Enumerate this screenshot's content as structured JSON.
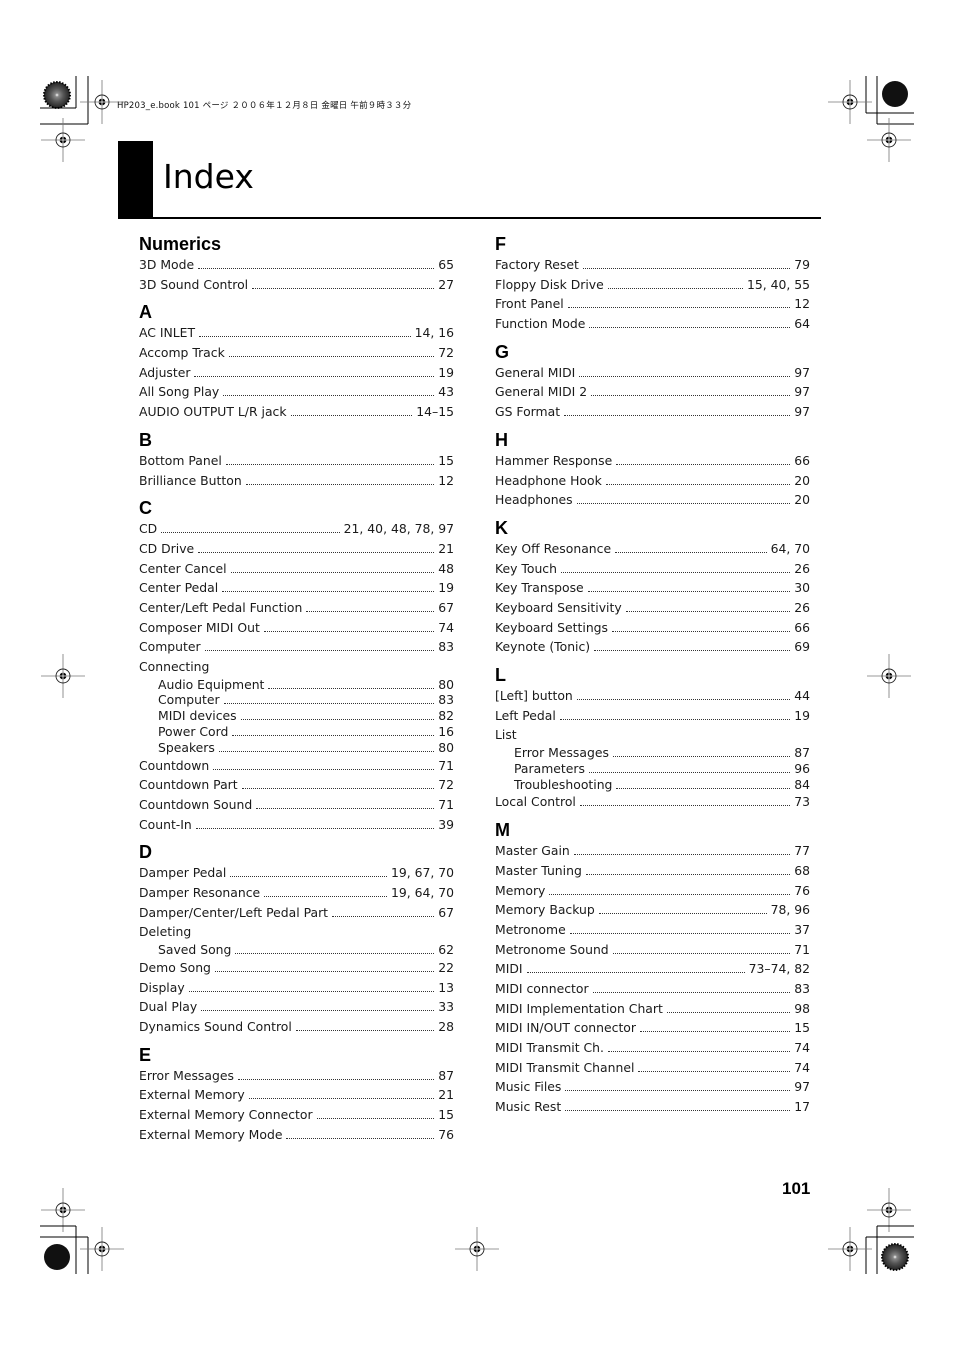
{
  "header": {
    "meta": "HP203_e.book  101 ページ  ２００６年１２月８日  金曜日  午前９時３３分"
  },
  "page_title": "Index",
  "page_number": "101",
  "left_column": [
    {
      "letter": "Numerics",
      "entries": [
        {
          "term": "3D Mode",
          "pages": "65"
        },
        {
          "term": "3D Sound Control",
          "pages": "27"
        }
      ]
    },
    {
      "letter": "A",
      "entries": [
        {
          "term": "AC INLET",
          "pages": "14, 16"
        },
        {
          "term": "Accomp Track",
          "pages": "72"
        },
        {
          "term": "Adjuster",
          "pages": "19"
        },
        {
          "term": "All Song Play",
          "pages": "43"
        },
        {
          "term": "AUDIO OUTPUT L/R jack",
          "pages": "14–15"
        }
      ]
    },
    {
      "letter": "B",
      "entries": [
        {
          "term": "Bottom Panel",
          "pages": "15"
        },
        {
          "term": "Brilliance Button",
          "pages": "12"
        }
      ]
    },
    {
      "letter": "C",
      "entries": [
        {
          "term": "CD",
          "pages": "21, 40, 48, 78, 97"
        },
        {
          "term": "CD Drive",
          "pages": "21"
        },
        {
          "term": "Center Cancel",
          "pages": "48"
        },
        {
          "term": "Center Pedal",
          "pages": "19"
        },
        {
          "term": "Center/Left Pedal Function",
          "pages": "67"
        },
        {
          "term": "Composer MIDI Out",
          "pages": "74"
        },
        {
          "term": "Computer",
          "pages": "83"
        },
        {
          "term": "Connecting",
          "pages": "",
          "parent": true
        },
        {
          "term": "Audio Equipment",
          "pages": "80",
          "sub": true
        },
        {
          "term": "Computer",
          "pages": "83",
          "sub": true
        },
        {
          "term": "MIDI devices",
          "pages": "82",
          "sub": true
        },
        {
          "term": "Power Cord",
          "pages": "16",
          "sub": true
        },
        {
          "term": "Speakers",
          "pages": "80",
          "sub": true
        },
        {
          "term": "Countdown",
          "pages": "71"
        },
        {
          "term": "Countdown Part",
          "pages": "72"
        },
        {
          "term": "Countdown Sound",
          "pages": "71"
        },
        {
          "term": "Count-In",
          "pages": "39"
        }
      ]
    },
    {
      "letter": "D",
      "entries": [
        {
          "term": "Damper Pedal",
          "pages": "19, 67, 70"
        },
        {
          "term": "Damper Resonance",
          "pages": "19, 64, 70"
        },
        {
          "term": "Damper/Center/Left Pedal Part",
          "pages": "67"
        },
        {
          "term": "Deleting",
          "pages": "",
          "parent": true
        },
        {
          "term": "Saved Song",
          "pages": "62",
          "sub": true
        },
        {
          "term": "Demo Song",
          "pages": "22"
        },
        {
          "term": "Display",
          "pages": "13"
        },
        {
          "term": "Dual Play",
          "pages": "33"
        },
        {
          "term": "Dynamics Sound Control",
          "pages": "28"
        }
      ]
    },
    {
      "letter": "E",
      "entries": [
        {
          "term": "Error Messages",
          "pages": "87"
        },
        {
          "term": "External Memory",
          "pages": "21"
        },
        {
          "term": "External Memory Connector",
          "pages": "15"
        },
        {
          "term": "External Memory Mode",
          "pages": "76"
        }
      ]
    }
  ],
  "right_column": [
    {
      "letter": "F",
      "entries": [
        {
          "term": "Factory Reset",
          "pages": "79"
        },
        {
          "term": "Floppy Disk Drive",
          "pages": "15, 40, 55"
        },
        {
          "term": "Front Panel",
          "pages": "12"
        },
        {
          "term": "Function Mode",
          "pages": "64"
        }
      ]
    },
    {
      "letter": "G",
      "entries": [
        {
          "term": "General MIDI",
          "pages": "97"
        },
        {
          "term": "General MIDI 2",
          "pages": "97"
        },
        {
          "term": "GS Format",
          "pages": "97"
        }
      ]
    },
    {
      "letter": "H",
      "entries": [
        {
          "term": "Hammer Response",
          "pages": "66"
        },
        {
          "term": "Headphone Hook",
          "pages": "20"
        },
        {
          "term": "Headphones",
          "pages": "20"
        }
      ]
    },
    {
      "letter": "K",
      "entries": [
        {
          "term": "Key Off Resonance",
          "pages": "64, 70"
        },
        {
          "term": "Key Touch",
          "pages": "26"
        },
        {
          "term": "Key Transpose",
          "pages": "30"
        },
        {
          "term": "Keyboard Sensitivity",
          "pages": "26"
        },
        {
          "term": "Keyboard Settings",
          "pages": "66"
        },
        {
          "term": "Keynote (Tonic)",
          "pages": "69"
        }
      ]
    },
    {
      "letter": "L",
      "entries": [
        {
          "term": "[Left] button",
          "pages": "44"
        },
        {
          "term": "Left Pedal",
          "pages": "19"
        },
        {
          "term": "List",
          "pages": "",
          "parent": true
        },
        {
          "term": "Error Messages",
          "pages": "87",
          "sub": true
        },
        {
          "term": "Parameters",
          "pages": "96",
          "sub": true
        },
        {
          "term": "Troubleshooting",
          "pages": "84",
          "sub": true
        },
        {
          "term": "Local Control",
          "pages": "73"
        }
      ]
    },
    {
      "letter": "M",
      "entries": [
        {
          "term": "Master Gain",
          "pages": "77"
        },
        {
          "term": "Master Tuning",
          "pages": "68"
        },
        {
          "term": "Memory",
          "pages": "76"
        },
        {
          "term": "Memory Backup",
          "pages": "78, 96"
        },
        {
          "term": "Metronome",
          "pages": "37"
        },
        {
          "term": "Metronome Sound",
          "pages": "71"
        },
        {
          "term": "MIDI",
          "pages": "73–74, 82"
        },
        {
          "term": "MIDI connector",
          "pages": "83"
        },
        {
          "term": "MIDI Implementation Chart",
          "pages": "98"
        },
        {
          "term": "MIDI IN/OUT connector",
          "pages": "15"
        },
        {
          "term": "MIDI Transmit Ch.",
          "pages": "74"
        },
        {
          "term": "MIDI Transmit Channel",
          "pages": "74"
        },
        {
          "term": "Music Files",
          "pages": "97"
        },
        {
          "term": "Music Rest",
          "pages": "17"
        }
      ]
    }
  ]
}
